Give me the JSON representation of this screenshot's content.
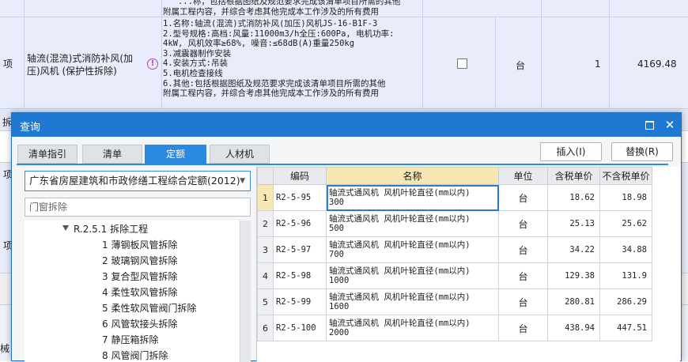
{
  "background": {
    "top_desc": "   ...称，包括根据图纸及规范要求完成该清单项目所需的其他\n附属工程内容，并综合考虑其他完成本工作涉及的所有费用",
    "row": {
      "type": "项",
      "name": "轴流(混流)式消防补风(加压)风机 (保护性拆除)",
      "desc": "1.名称:轴流(混流)式消防补风(加压)风机JS-16-B1F-3\n2.型号规格:高档:风量:11000m3/h全压:600Pa, 电机功率:\n4kW, 风机效率≥68%, 噪音:≤68dB(A)重量250kg\n3.减震器制作安装\n4.安装方式:吊装\n5.电机检查接线\n6.其他:包括根据图纸及规范要求完成该清单项目所需的其他\n附属工程内容，并综合考虑其他完成本工作涉及的所有费用",
      "unit": "台",
      "qty": "1",
      "price": "4169.48",
      "warn_glyph": "!"
    },
    "side_labels": [
      "拆",
      "项",
      "项",
      "械"
    ]
  },
  "dialog": {
    "title": "查询",
    "tabs": [
      {
        "label": "清单指引"
      },
      {
        "label": "清单"
      },
      {
        "label": "定额",
        "active": true
      },
      {
        "label": "人材机"
      }
    ],
    "insert_button": "插入(I)",
    "replace_button": "替换(R)",
    "quota_library": "广东省房屋建筑和市政修缮工程综合定额(2012)",
    "search_placeholder": "门窗拆除",
    "tree": {
      "parent": "R.2.5.1 拆除工程",
      "children": [
        "1 薄钢板风管拆除",
        "2 玻璃钢风管拆除",
        "3 复合型风管拆除",
        "4 柔性软风管拆除",
        "5 柔性软风管阀门拆除",
        "6 风管软接头拆除",
        "7 静压箱拆除",
        "8 风管阀门拆除"
      ]
    },
    "table": {
      "columns": [
        "编码",
        "名称",
        "单位",
        "含税单价",
        "不含税单价"
      ],
      "rows": [
        {
          "idx": "1",
          "code": "R2-5-95",
          "name1": "轴流式通风机 风机叶轮直径(mm以内)",
          "name2": "300",
          "unit": "台",
          "tax_price": "18.62",
          "notax_price": "18.98"
        },
        {
          "idx": "2",
          "code": "R2-5-96",
          "name1": "轴流式通风机 风机叶轮直径(mm以内)",
          "name2": "500",
          "unit": "台",
          "tax_price": "25.13",
          "notax_price": "25.62"
        },
        {
          "idx": "3",
          "code": "R2-5-97",
          "name1": "轴流式通风机 风机叶轮直径(mm以内)",
          "name2": "700",
          "unit": "台",
          "tax_price": "34.22",
          "notax_price": "34.88"
        },
        {
          "idx": "4",
          "code": "R2-5-98",
          "name1": "轴流式通风机 风机叶轮直径(mm以内)",
          "name2": "1000",
          "unit": "台",
          "tax_price": "129.38",
          "notax_price": "131.9"
        },
        {
          "idx": "5",
          "code": "R2-5-99",
          "name1": "轴流式通风机 风机叶轮直径(mm以内)",
          "name2": "1600",
          "unit": "台",
          "tax_price": "280.81",
          "notax_price": "286.29"
        },
        {
          "idx": "6",
          "code": "R2-5-100",
          "name1": "轴流式通风机 风机叶轮直径(mm以内)",
          "name2": "2000",
          "unit": "台",
          "tax_price": "438.94",
          "notax_price": "447.51"
        }
      ]
    }
  }
}
